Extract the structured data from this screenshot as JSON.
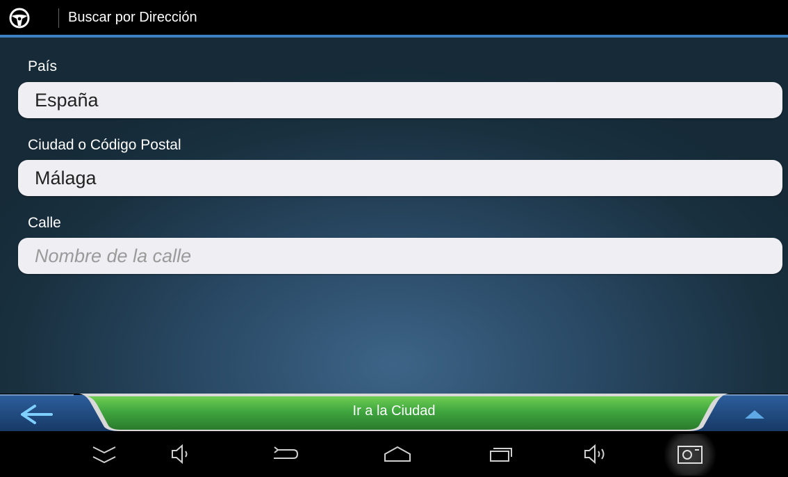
{
  "header": {
    "title": "Buscar por Dirección",
    "app_icon": "steering-wheel-icon"
  },
  "form": {
    "country": {
      "label": "País",
      "value": "España"
    },
    "city": {
      "label": "Ciudad o Código Postal",
      "value": "Málaga"
    },
    "street": {
      "label": "Calle",
      "value": "",
      "placeholder": "Nombre de la calle"
    }
  },
  "actions": {
    "back_icon": "arrow-left-icon",
    "go_label": "Ir a la Ciudad",
    "up_icon": "chevron-up-icon",
    "go_color": "#3fa63f"
  },
  "system_nav": {
    "buttons": [
      {
        "name": "hide-bar-icon"
      },
      {
        "name": "volume-down-icon"
      },
      {
        "name": "back-icon"
      },
      {
        "name": "home-icon"
      },
      {
        "name": "recent-apps-icon"
      },
      {
        "name": "volume-up-icon"
      },
      {
        "name": "screenshot-icon"
      }
    ]
  },
  "colors": {
    "accent": "#3c7fc2",
    "background": "#223d52"
  }
}
